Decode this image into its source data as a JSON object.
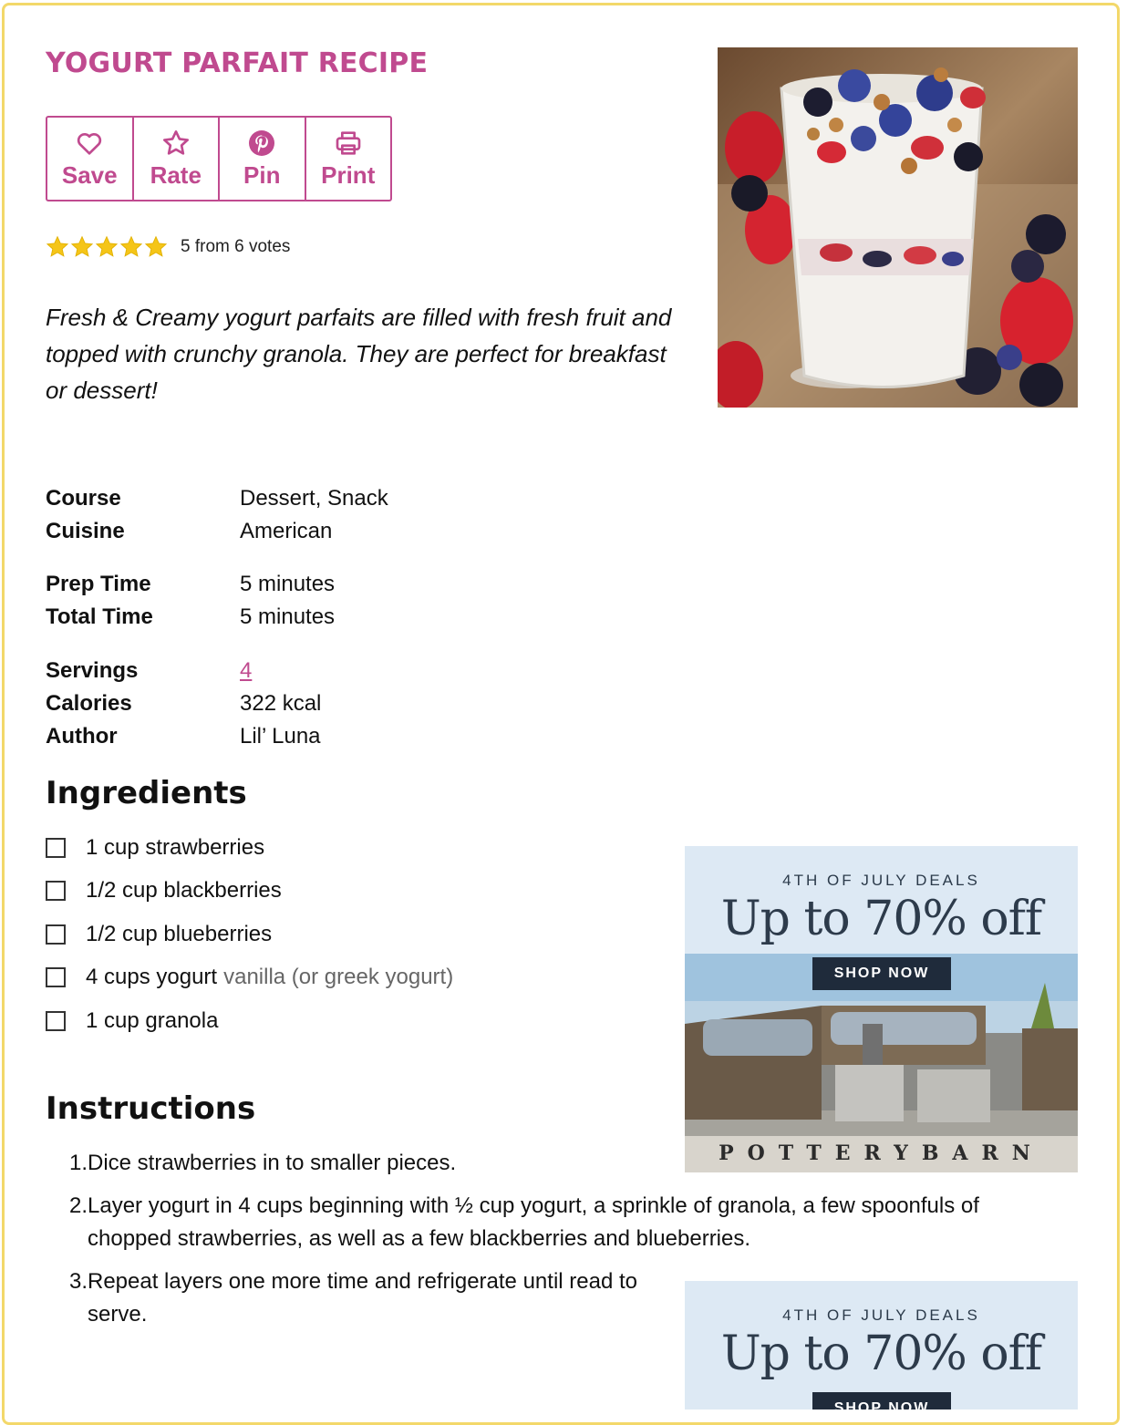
{
  "recipe": {
    "title": "YOGURT PARFAIT RECIPE",
    "actions": [
      {
        "label": "Save",
        "icon": "heart-icon"
      },
      {
        "label": "Rate",
        "icon": "star-icon"
      },
      {
        "label": "Pin",
        "icon": "pinterest-icon"
      },
      {
        "label": "Print",
        "icon": "printer-icon"
      }
    ],
    "rating": {
      "stars": 5,
      "max_stars": 5,
      "text": "5 from 6 votes"
    },
    "summary": "Fresh & Creamy yogurt parfaits are filled with fresh fruit and topped with crunchy granola. They are perfect for breakfast or dessert!",
    "meta": {
      "course_label": "Course",
      "course": "Dessert, Snack",
      "cuisine_label": "Cuisine",
      "cuisine": "American",
      "prep_label": "Prep Time",
      "prep": "5 minutes",
      "total_label": "Total Time",
      "total": "5 minutes",
      "servings_label": "Servings",
      "servings": "4",
      "calories_label": "Calories",
      "calories": "322 kcal",
      "author_label": "Author",
      "author": "Lil’ Luna"
    },
    "ingredients_heading": "Ingredients",
    "ingredients": [
      {
        "text": "1 cup strawberries",
        "note": ""
      },
      {
        "text": "1/2 cup blackberries",
        "note": ""
      },
      {
        "text": "1/2 cup blueberries",
        "note": ""
      },
      {
        "text": "4 cups yogurt",
        "note": "vanilla (or greek yogurt)"
      },
      {
        "text": "1 cup granola",
        "note": ""
      }
    ],
    "instructions_heading": "Instructions",
    "instructions": [
      {
        "num": "1.",
        "text": "Dice strawberries in to smaller pieces."
      },
      {
        "num": "2.",
        "text": "Layer yogurt in 4 cups beginning with ½ cup yogurt, a sprinkle of granola, a few spoonfuls of chopped strawberries, as well as a few blackberries and blueberries."
      },
      {
        "num": "3.",
        "text": "Repeat layers one more time and refrigerate until read to serve."
      }
    ]
  },
  "ads": [
    {
      "kicker": "4TH OF JULY DEALS",
      "headline": "Up to 70% off",
      "cta": "SHOP NOW",
      "brand": "POTTERYBARN"
    },
    {
      "kicker": "4TH OF JULY DEALS",
      "headline": "Up to 70% off",
      "cta": "SHOP NOW"
    }
  ],
  "colors": {
    "accent": "#c04a8f",
    "border": "#f3d86a",
    "star": "#f5c518"
  }
}
